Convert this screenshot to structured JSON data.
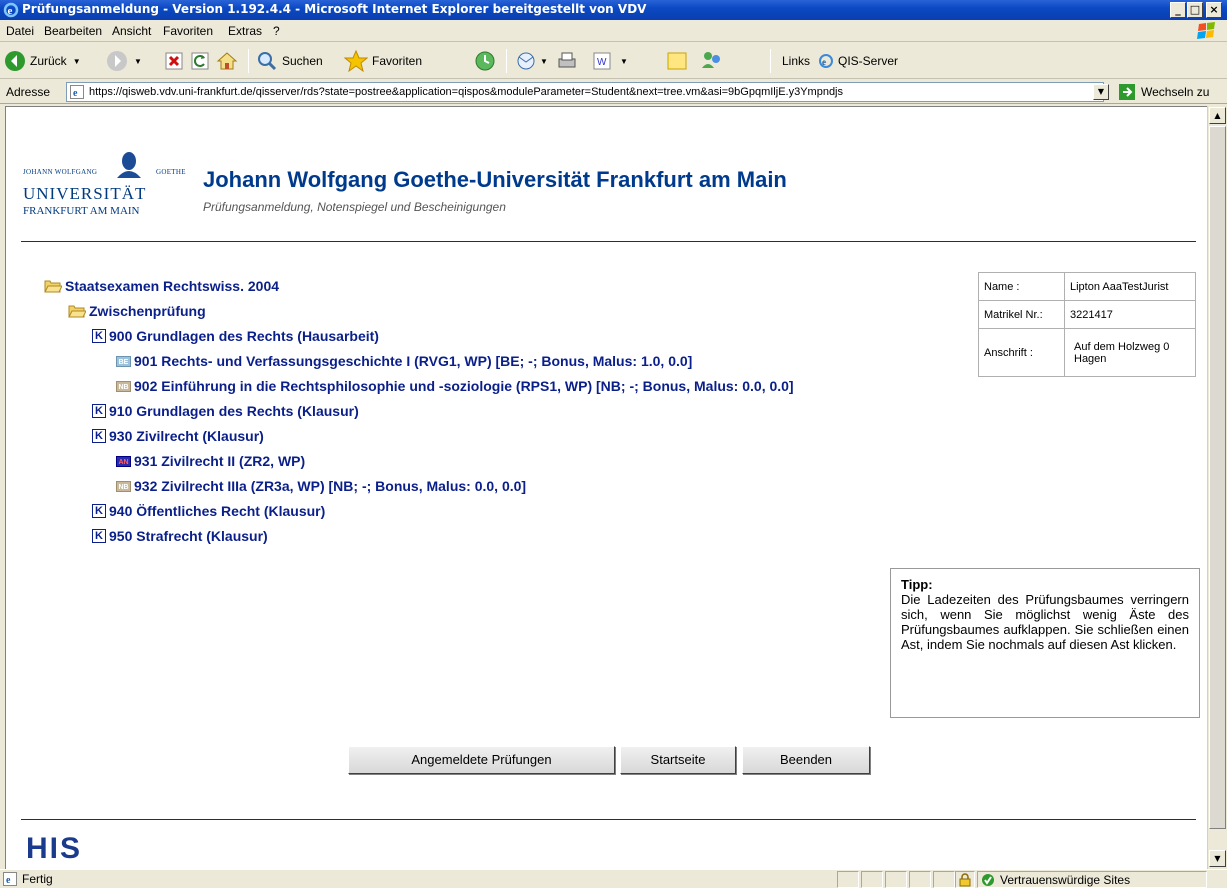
{
  "window": {
    "title": "Prüfungsanmeldung - Version 1.192.4.4 - Microsoft Internet Explorer bereitgestellt von VDV",
    "min": "_",
    "max": "□",
    "close": "×"
  },
  "menu": [
    "Datei",
    "Bearbeiten",
    "Ansicht",
    "Favoriten",
    "Extras",
    "?"
  ],
  "toolbar": {
    "back": "Zurück",
    "search": "Suchen",
    "favorites": "Favoriten",
    "links": "Links",
    "qis": "QIS-Server"
  },
  "address": {
    "label": "Adresse",
    "url": "https://qisweb.vdv.uni-frankfurt.de/qisserver/rds?state=postree&application=qispos&moduleParameter=Student&next=tree.vm&asi=9bGpqmIljE.y3Ympndjs",
    "go": "Wechseln zu"
  },
  "header": {
    "logo_small_left": "JOHANN WOLFGANG",
    "logo_small_right": "GOETHE",
    "logo_big": "UNIVERSITÄT",
    "logo_city": "FRANKFURT AM MAIN",
    "title": "Johann Wolfgang Goethe-Universität Frankfurt am Main",
    "subtitle": "Prüfungsanmeldung, Notenspiegel und Bescheinigungen"
  },
  "tree": [
    {
      "icon": "folder",
      "text": "Staatsexamen Rechtswiss. 2004"
    },
    {
      "icon": "folder",
      "text": "Zwischenprüfung"
    },
    {
      "icon": "K",
      "text": "900 Grundlagen des Rechts (Hausarbeit)"
    },
    {
      "icon": "BE",
      "text": "901 Rechts- und Verfassungsgeschichte I (RVG1, WP)  [BE; -; Bonus, Malus: 1.0, 0.0]"
    },
    {
      "icon": "NB",
      "text": "902 Einführung in die Rechtsphilosophie und -soziologie (RPS1, WP)  [NB; -; Bonus, Malus: 0.0, 0.0]"
    },
    {
      "icon": "K",
      "text": "910 Grundlagen des Rechts (Klausur)"
    },
    {
      "icon": "K",
      "text": "930 Zivilrecht (Klausur)"
    },
    {
      "icon": "AN",
      "text": "931 Zivilrecht II (ZR2, WP)"
    },
    {
      "icon": "NB",
      "text": "932 Zivilrecht IIIa (ZR3a, WP)  [NB; -; Bonus, Malus: 0.0, 0.0]"
    },
    {
      "icon": "K",
      "text": "940 Öffentliches Recht (Klausur)"
    },
    {
      "icon": "K",
      "text": "950 Strafrecht (Klausur)"
    }
  ],
  "icon_labels": {
    "K": "K",
    "BE": "BE",
    "NB": "NB",
    "AN": "AN"
  },
  "info": {
    "name_label": "Name :",
    "name": "Lipton AaaTestJurist",
    "matrikel_label": "Matrikel Nr.:",
    "matrikel": "3221417",
    "address_label": "Anschrift :",
    "address_line1": "Auf dem Holzweg 0",
    "address_line2": "Hagen"
  },
  "tip": {
    "heading": "Tipp:",
    "text": "Die Ladezeiten des Prüfungsbaumes verringern sich, wenn Sie möglichst wenig Äste des Prüfungsbaumes aufklappen. Sie schließen einen Ast, indem Sie nochmals auf diesen Ast klicken."
  },
  "buttons": {
    "registered": "Angemeldete Prüfungen",
    "home": "Startseite",
    "quit": "Beenden"
  },
  "footer": {
    "his": "HIS"
  },
  "status": {
    "text": "Fertig",
    "zone": "Vertrauenswürdige Sites"
  }
}
